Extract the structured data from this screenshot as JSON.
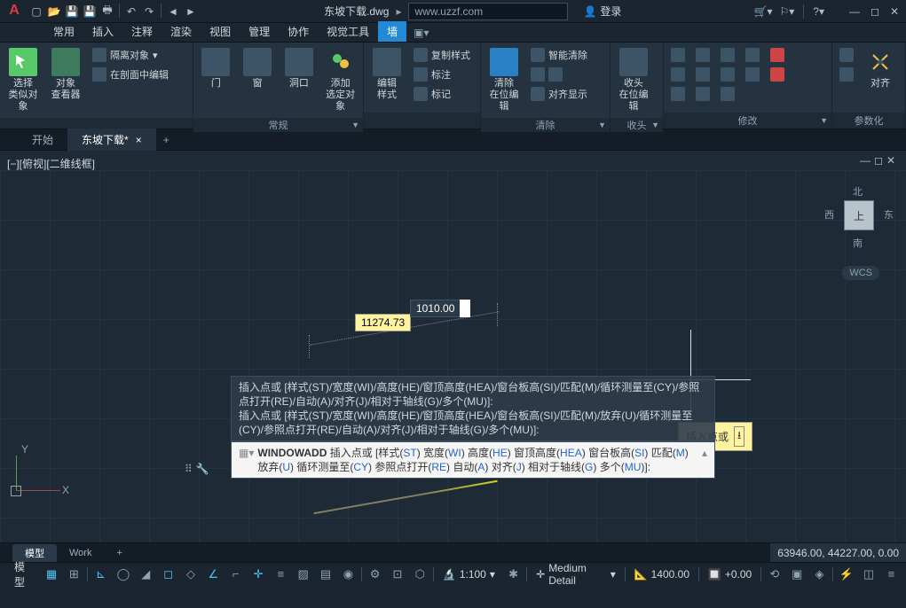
{
  "app": {
    "logo": "A"
  },
  "title": {
    "filename": "东坡下载.dwg",
    "search_placeholder": "www.uzzf.com",
    "login": "登录"
  },
  "ribbon_tabs": [
    "常用",
    "插入",
    "注释",
    "渲染",
    "视图",
    "管理",
    "协作",
    "视觉工具",
    "墙"
  ],
  "ribbon_active": 8,
  "panels": {
    "p1": {
      "title": "",
      "b1": "选择\n类似对象",
      "b2": "对象\n查看器",
      "s1": "隔离对象",
      "s2": "在剖面中编辑"
    },
    "p2": {
      "title": "常规",
      "b1": "门",
      "b2": "窗",
      "b3": "洞口",
      "b4": "添加\n选定对象"
    },
    "p3": {
      "title": "",
      "b1": "编辑\n样式",
      "s1": "复制样式",
      "s2": "标注",
      "s3": "标记"
    },
    "p4": {
      "title": "清除",
      "b1": "清除\n在位编辑",
      "s1": "智能清除",
      "s3": "对齐显示"
    },
    "p5": {
      "title": "收头",
      "b1": "收头\n在位编辑"
    },
    "p6": {
      "title": "修改"
    },
    "p7": {
      "title": "参数化",
      "b1": "对齐"
    }
  },
  "doctabs": {
    "t1": "开始",
    "t2": "东坡下载*"
  },
  "viewport": {
    "label": "[−][俯视][二维线框]",
    "dim1": "11274.73",
    "input1": "1010.00",
    "tooltip": "插入点或",
    "viewcube": {
      "center": "上",
      "n": "北",
      "s": "南",
      "e": "东",
      "w": "西"
    },
    "wcs": "WCS",
    "ucs": {
      "x": "X",
      "y": "Y"
    }
  },
  "cmd": {
    "h1": "插入点或 [样式(ST)/宽度(WI)/高度(HE)/窗顶高度(HEA)/窗台板高(SI)/匹配(M)/循环测量至(CY)/参照点打开(RE)/自动(A)/对齐(J)/相对于轴线(G)/多个(MU)]:",
    "h2": "插入点或 [样式(ST)/宽度(WI)/高度(HE)/窗顶高度(HEA)/窗台板高(SI)/匹配(M)/放弃(U)/循环测量至(CY)/参照点打开(RE)/自动(A)/对齐(J)/相对于轴线(G)/多个(MU)]:",
    "prompt_cmd": "WINDOWADD",
    "prompt_text": " 插入点或 [",
    "opts": [
      "样式(ST)",
      "宽度(WI)",
      "高度(HE)",
      "窗顶高度(HEA)",
      "窗台板高(SI)",
      "匹配(M)",
      "放弃(U)",
      "循环测量至(CY)",
      "参照点打开(RE)",
      "自动(A)",
      "对齐(J)",
      "相对于轴线(G)",
      "多个(MU)"
    ]
  },
  "layout": {
    "t1": "模型",
    "t2": "Work"
  },
  "coords": "63946.00, 44227.00, 0.00",
  "status": {
    "model": "模型",
    "scale": "1:100",
    "detail": "Medium Detail",
    "elev": "1400.00",
    "cut": "+0.00"
  }
}
